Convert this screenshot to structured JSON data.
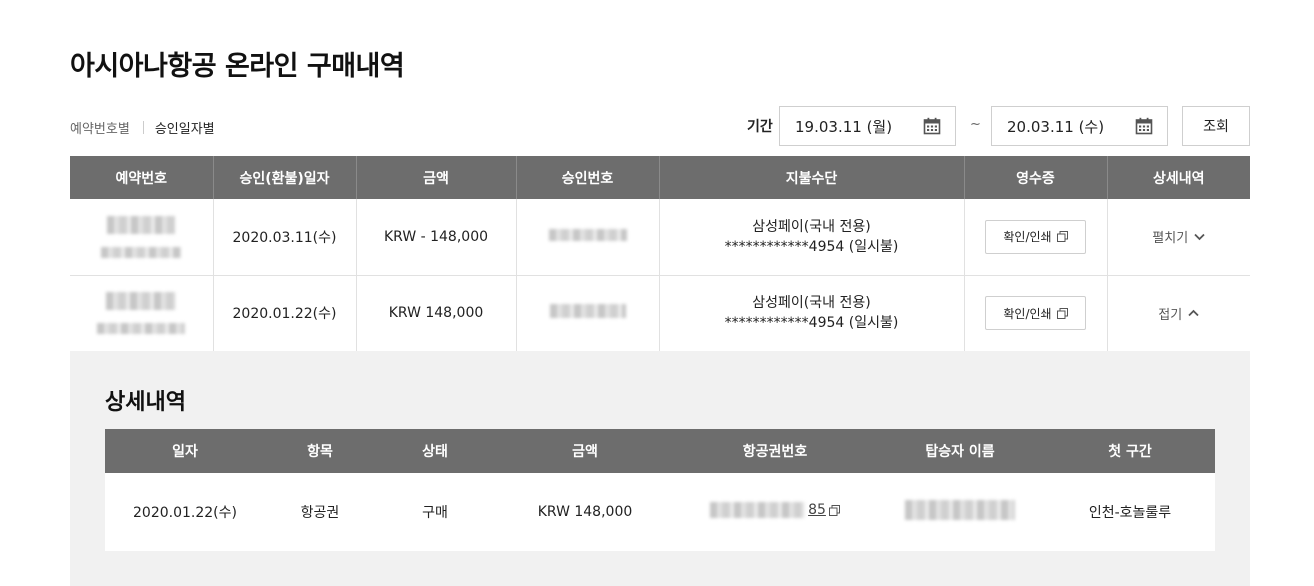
{
  "page": {
    "title": "아시아나항공 온라인 구매내역"
  },
  "filter": {
    "tab_booking": "예약번호별",
    "tab_approval": "승인일자별"
  },
  "period": {
    "label": "기간",
    "from": "19.03.11 (월)",
    "separator": "~",
    "to": "20.03.11 (수)",
    "search_label": "조회"
  },
  "table": {
    "headers": [
      "예약번호",
      "승인(환불)일자",
      "금액",
      "승인번호",
      "지불수단",
      "영수증",
      "상세내역"
    ],
    "rows": [
      {
        "date": "2020.03.11(수)",
        "amount": "KRW - 148,000",
        "pay_line1": "삼성페이(국내 전용)",
        "pay_line2": "************4954  (일시불)",
        "receipt": "확인/인쇄",
        "toggle": "펼치기"
      },
      {
        "date": "2020.01.22(수)",
        "amount": "KRW 148,000",
        "pay_line1": "삼성페이(국내 전용)",
        "pay_line2": "************4954  (일시불)",
        "receipt": "확인/인쇄",
        "toggle": "접기"
      }
    ]
  },
  "detail": {
    "title": "상세내역",
    "headers": [
      "일자",
      "항목",
      "상태",
      "금액",
      "항공권번호",
      "탑승자 이름",
      "첫 구간"
    ],
    "row": {
      "date": "2020.01.22(수)",
      "item": "항공권",
      "status": "구매",
      "amount": "KRW 148,000",
      "ticket_suffix": "85",
      "route": "인천-호놀룰루"
    }
  },
  "colors": {
    "header_bg": "#6d6d6d",
    "amount_red": "#a4293a",
    "panel_bg": "#f1f1f1"
  },
  "icons": {
    "calendar": "calendar-icon",
    "copy": "copy-icon",
    "chevron_down": "chevron-down-icon",
    "chevron_up": "chevron-up-icon"
  }
}
